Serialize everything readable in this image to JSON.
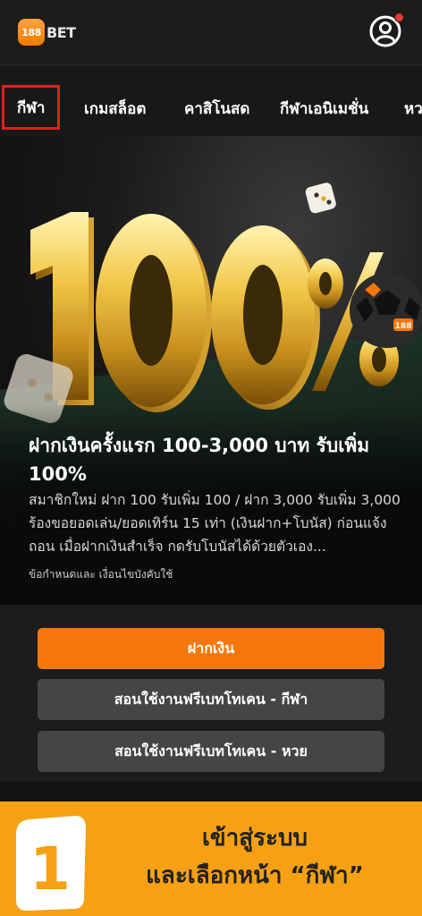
{
  "header": {
    "logo_number": "188",
    "logo_text": "BET",
    "account_icon": "user-circle-icon",
    "notification_color": "#e53935"
  },
  "nav": {
    "items": [
      {
        "label": "กีฬา",
        "active": true
      },
      {
        "label": "เกมสล็อต",
        "active": false
      },
      {
        "label": "คาสิโนสด",
        "active": false
      },
      {
        "label": "กีฬาเอนิเมชั่น",
        "active": false
      },
      {
        "label": "หวย",
        "active": false
      }
    ]
  },
  "hero": {
    "graphic_text": "100%",
    "ball_label": "188",
    "title": "ฝากเงินครั้งแรก 100-3,000 บาท รับเพิ่ม 100%",
    "description": "สมาชิกใหม่ ฝาก 100 รับเพิ่ม 100 / ฝาก 3,000 รับเพิ่ม 3,000 ร้องขอยอดเล่น/ยอดเทิร์น 15 เท่า (เงินฝาก+โบนัส) ก่อนแจ้งถอน เมื่อฝากเงินสำเร็จ กดรับโบนัสได้ด้วยตัวเอง...",
    "terms_link": "ข้อกำหนดและ เงื่อนไขบังคับใช้"
  },
  "actions": {
    "deposit_label": "ฝากเงิน",
    "tutorial_sports_label": "สอนใช้งานฟรีเบทโทเคน - กีฬา",
    "tutorial_lottery_label": "สอนใช้งานฟรีเบทโทเคน - หวย"
  },
  "step": {
    "number": "1",
    "line1": "เข้าสู่ระบบ",
    "line2": "และเลือกหน้า “กีฬา”"
  },
  "colors": {
    "accent": "#f5770c",
    "step_background": "#f6a114",
    "active_outline": "#e0201b"
  }
}
